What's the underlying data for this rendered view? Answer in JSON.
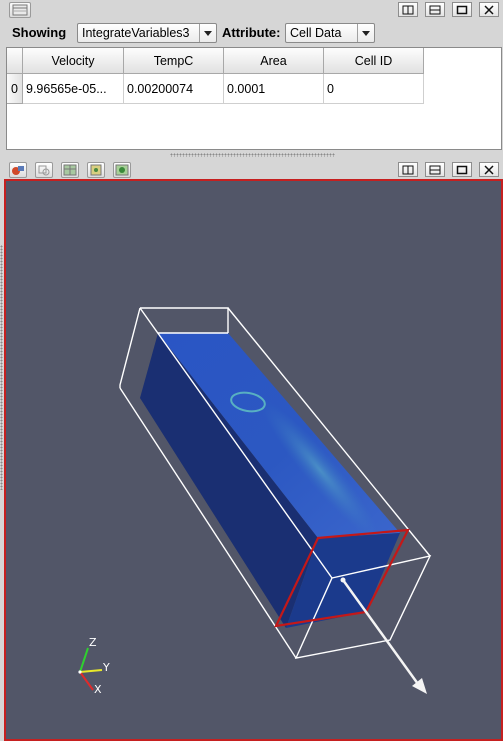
{
  "top_panel": {
    "showing_label": "Showing",
    "source_value": "IntegrateVariables3",
    "attribute_label": "Attribute:",
    "attribute_value": "Cell Data"
  },
  "table": {
    "columns": [
      "Velocity",
      "TempC",
      "Area",
      "Cell ID"
    ],
    "rows": [
      {
        "index": "0",
        "cells": [
          "9.96565e-05...",
          "0.00200074",
          "0.0001",
          "0"
        ]
      }
    ]
  },
  "orientation_axes": {
    "z": "Z",
    "y": "Y",
    "x": "X"
  },
  "colors": {
    "view_background": "#525668",
    "active_view_border": "#c62020",
    "object_fill": "#1f3f9a",
    "outline": "#ffffff",
    "slice_outline": "#c41818"
  },
  "icons": {
    "top_panel": [
      "table-view-icon"
    ],
    "view_toolbar": [
      "reset-camera-icon",
      "zoom-to-box-icon",
      "select-cells-icon",
      "select-points-icon",
      "select-frustum-icon"
    ],
    "window_controls": [
      "split-horizontal-icon",
      "split-vertical-icon",
      "maximize-icon",
      "close-icon"
    ]
  }
}
